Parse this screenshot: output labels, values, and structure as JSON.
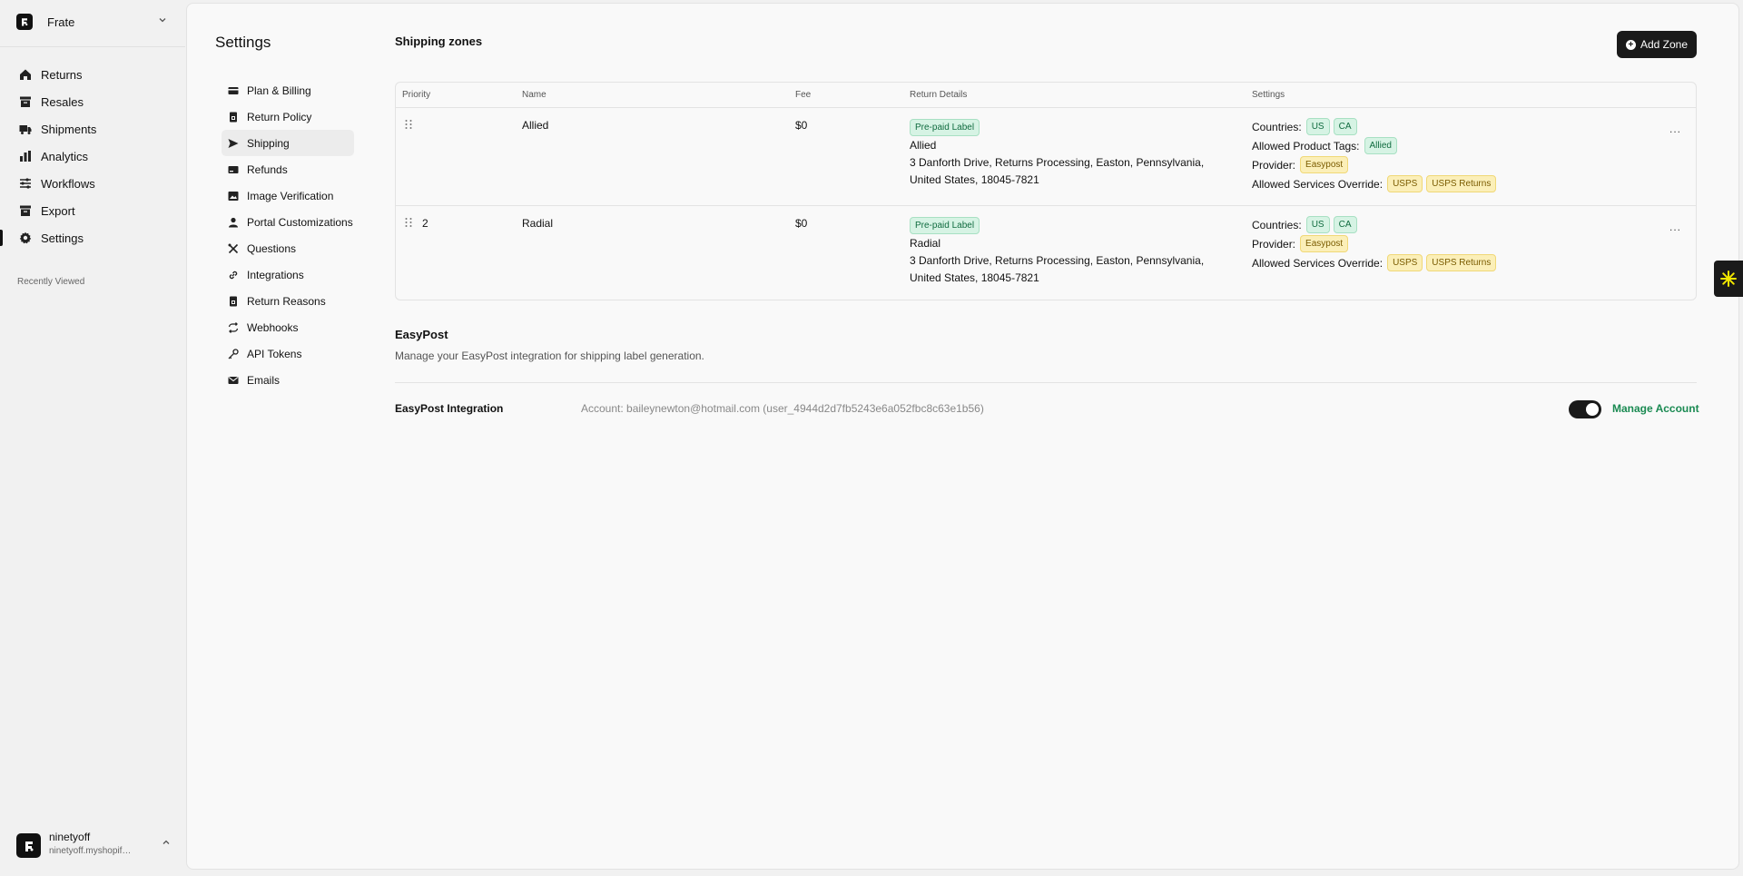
{
  "workspace": {
    "name": "Frate"
  },
  "nav": [
    {
      "label": "Returns",
      "icon": "home-icon"
    },
    {
      "label": "Resales",
      "icon": "archive-icon"
    },
    {
      "label": "Shipments",
      "icon": "truck-icon"
    },
    {
      "label": "Analytics",
      "icon": "bar-chart-icon"
    },
    {
      "label": "Workflows",
      "icon": "sliders-icon"
    },
    {
      "label": "Export",
      "icon": "archive-icon"
    },
    {
      "label": "Settings",
      "icon": "gear-icon",
      "active": true
    }
  ],
  "recently_viewed_label": "Recently Viewed",
  "user": {
    "name": "ninetyoff",
    "store": "ninetyoff.myshopify.com"
  },
  "settings": {
    "title": "Settings",
    "sub_nav": [
      {
        "label": "Plan & Billing",
        "icon": "credit-card-icon"
      },
      {
        "label": "Return Policy",
        "icon": "document-lock-icon"
      },
      {
        "label": "Shipping",
        "icon": "send-icon",
        "active": true
      },
      {
        "label": "Refunds",
        "icon": "refund-icon"
      },
      {
        "label": "Image Verification",
        "icon": "image-icon"
      },
      {
        "label": "Portal Customizations",
        "icon": "user-icon"
      },
      {
        "label": "Questions",
        "icon": "tools-icon"
      },
      {
        "label": "Integrations",
        "icon": "link-icon"
      },
      {
        "label": "Return Reasons",
        "icon": "document-lock-icon"
      },
      {
        "label": "Webhooks",
        "icon": "repeat-icon"
      },
      {
        "label": "API Tokens",
        "icon": "key-icon"
      },
      {
        "label": "Emails",
        "icon": "mail-icon"
      }
    ]
  },
  "shipping_zones": {
    "title": "Shipping zones",
    "add_button": "Add Zone",
    "columns": [
      "Priority",
      "Name",
      "Fee",
      "Return Details",
      "Settings"
    ],
    "rows": [
      {
        "priority": "",
        "name": "Allied",
        "fee": "$0",
        "label_badge": "Pre-paid Label",
        "detail_name": "Allied",
        "address_line1": "3 Danforth Drive, Returns Processing, Easton, Pennsylvania,",
        "address_line2": "United States, 18045-7821",
        "countries_label": "Countries:",
        "countries": [
          "US",
          "CA"
        ],
        "tags_label": "Allowed Product Tags:",
        "tags": [
          "Allied"
        ],
        "provider_label": "Provider:",
        "provider": "Easypost",
        "services_label": "Allowed Services Override:",
        "services": [
          "USPS",
          "USPS Returns"
        ],
        "more": "..."
      },
      {
        "priority": "2",
        "name": "Radial",
        "fee": "$0",
        "label_badge": "Pre-paid Label",
        "detail_name": "Radial",
        "address_line1": "3 Danforth Drive, Returns Processing, Easton, Pennsylvania,",
        "address_line2": "United States, 18045-7821",
        "countries_label": "Countries:",
        "countries": [
          "US",
          "CA"
        ],
        "provider_label": "Provider:",
        "provider": "Easypost",
        "services_label": "Allowed Services Override:",
        "services": [
          "USPS",
          "USPS Returns"
        ],
        "more": "..."
      }
    ]
  },
  "easypost": {
    "title": "EasyPost",
    "description": "Manage your EasyPost integration for shipping label generation.",
    "integration_label": "EasyPost Integration",
    "account_text": "Account: baileynewton@hotmail.com (user_4944d2d7fb5243e6a052fbc8c63e1b56)",
    "enabled": true,
    "manage_link": "Manage Account"
  },
  "colors": {
    "accent_green": "#1a8a52",
    "badge_green_bg": "#d6f3e4",
    "badge_yellow_bg": "#fbefb8",
    "dark": "#1a1a1a"
  }
}
